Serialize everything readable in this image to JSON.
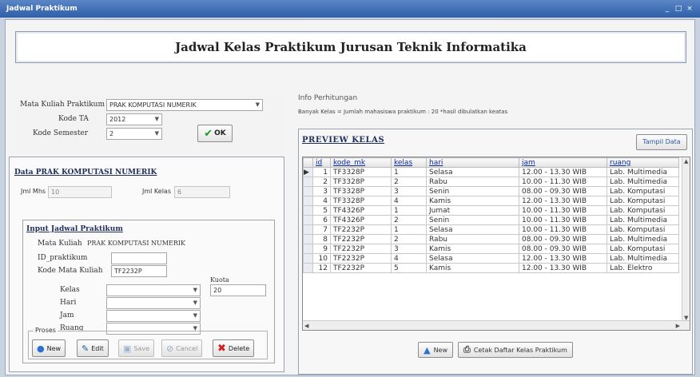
{
  "window": {
    "title": "Jadwal Praktikum",
    "controls": [
      "_",
      "□",
      "×"
    ]
  },
  "banner": {
    "title": "Jadwal Kelas Praktikum Jurusan Teknik Informatika"
  },
  "top_form": {
    "mata_kuliah_label": "Mata Kuliah Praktikum",
    "mata_kuliah_value": "PRAK KOMPUTASI NUMERIK",
    "kode_ta_label": "Kode TA",
    "kode_ta_value": "2012",
    "kode_semester_label": "Kode Semester",
    "kode_semester_value": "2",
    "ok_label": "OK"
  },
  "data_section": {
    "title": "Data PRAK KOMPUTASI NUMERIK",
    "jml_mhs_label": "Jml Mhs",
    "jml_mhs_value": "10",
    "jml_kelas_label": "Jml Kelas",
    "jml_kelas_value": "6"
  },
  "input_section": {
    "title": "Input Jadwal Praktikum",
    "mata_kuliah_label": "Mata Kuliah",
    "mata_kuliah_value": "PRAK KOMPUTASI NUMERIK",
    "id_praktikum_label": "ID_praktikum",
    "id_praktikum_value": "",
    "kode_mata_kuliah_label": "Kode Mata Kuliah",
    "kode_mata_kuliah_value": "TF2232P",
    "kuota_label": "Kuota",
    "kuota_value": "20",
    "kelas_label": "Kelas",
    "hari_label": "Hari",
    "jam_label": "Jam",
    "ruang_label": "Ruang"
  },
  "proses": {
    "legend": "Proses",
    "buttons": {
      "new": "New",
      "edit": "Edit",
      "save": "Save",
      "cancel": "Cancel",
      "delete": "Delete"
    }
  },
  "info": {
    "title": "Info Perhitungan",
    "text": "Banyak Kelas = Jumlah mahasiswa praktikum : 20   *hasil dibulatkan keatas"
  },
  "preview": {
    "title": "PREVIEW KELAS",
    "tampil_label": "Tampil Data",
    "columns": [
      "id",
      "kode_mk",
      "kelas",
      "hari",
      "jam",
      "ruang"
    ],
    "rows": [
      [
        "1",
        "TF3328P",
        "1",
        "Selasa",
        "12.00 - 13.30 WIB",
        "Lab. Multimedia"
      ],
      [
        "2",
        "TF3328P",
        "2",
        "Rabu",
        "10.00 - 11.30 WIB",
        "Lab. Multimedia"
      ],
      [
        "3",
        "TF3328P",
        "3",
        "Senin",
        "08.00 - 09.30 WIB",
        "Lab. Komputasi"
      ],
      [
        "4",
        "TF3328P",
        "4",
        "Kamis",
        "12.00 - 13.30 WIB",
        "Lab. Komputasi"
      ],
      [
        "5",
        "TF4326P",
        "1",
        "Jumat",
        "10.00 - 11.30 WIB",
        "Lab. Komputasi"
      ],
      [
        "6",
        "TF4326P",
        "2",
        "Senin",
        "10.00 - 11.30 WIB",
        "Lab. Multimedia"
      ],
      [
        "7",
        "TF2232P",
        "1",
        "Selasa",
        "10.00 - 11.30 WIB",
        "Lab. Komputasi"
      ],
      [
        "8",
        "TF2232P",
        "2",
        "Rabu",
        "08.00 - 09.30 WIB",
        "Lab. Multimedia"
      ],
      [
        "9",
        "TF2232P",
        "3",
        "Kamis",
        "08.00 - 09.30 WIB",
        "Lab. Komputasi"
      ],
      [
        "10",
        "TF2232P",
        "4",
        "Selasa",
        "12.00 - 13.30 WIB",
        "Lab. Multimedia"
      ],
      [
        "12",
        "TF2232P",
        "5",
        "Kamis",
        "12.00 - 13.30 WIB",
        "Lab. Elektro"
      ]
    ],
    "new_label": "New",
    "cetak_label": "Cetak Daftar Kelas Praktikum"
  }
}
